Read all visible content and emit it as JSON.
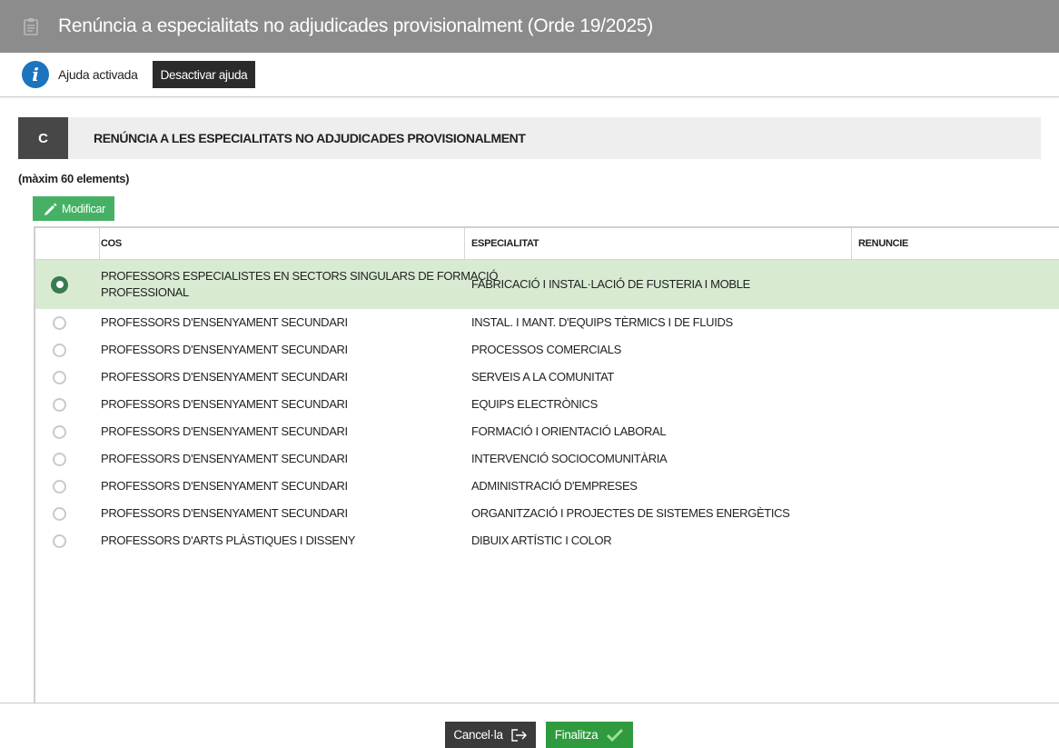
{
  "window": {
    "title": "Renúncia a especialitats no adjudicades provisionalment (Orde 19/2025)"
  },
  "help": {
    "status": "Ajuda activada",
    "toggle_label": "Desactivar ajuda"
  },
  "section": {
    "letter": "C",
    "title": "RENÚNCIA A LES ESPECIALITATS NO ADJUDICADES PROVISIONALMENT",
    "max_note": "(màxim 60 elements)",
    "modify_label": "Modificar"
  },
  "table": {
    "headers": {
      "cos": "COS",
      "especialitat": "ESPECIALITAT",
      "renuncie": "RENUNCIE"
    },
    "rows": [
      {
        "cos": "PROFESSORS ESPECIALISTES EN SECTORS SINGULARS DE FORMACIÓ PROFESSIONAL",
        "cos_line1": "PROFESSORS ESPECIALISTES EN SECTORS SINGULARS DE FORMACIÓ",
        "cos_line2": "PROFESSIONAL",
        "especialitat": "FABRICACIÓ I INSTAL·LACIÓ DE FUSTERIA I MOBLE",
        "renuncie": "",
        "selected": true
      },
      {
        "cos": "PROFESSORS D'ENSENYAMENT SECUNDARI",
        "especialitat": "INSTAL. I MANT. D'EQUIPS TÈRMICS I DE FLUIDS",
        "renuncie": "",
        "selected": false
      },
      {
        "cos": "PROFESSORS D'ENSENYAMENT SECUNDARI",
        "especialitat": "PROCESSOS COMERCIALS",
        "renuncie": "",
        "selected": false
      },
      {
        "cos": "PROFESSORS D'ENSENYAMENT SECUNDARI",
        "especialitat": "SERVEIS A LA COMUNITAT",
        "renuncie": "",
        "selected": false
      },
      {
        "cos": "PROFESSORS D'ENSENYAMENT SECUNDARI",
        "especialitat": "EQUIPS ELECTRÒNICS",
        "renuncie": "",
        "selected": false
      },
      {
        "cos": "PROFESSORS D'ENSENYAMENT SECUNDARI",
        "especialitat": "FORMACIÓ I ORIENTACIÓ LABORAL",
        "renuncie": "",
        "selected": false
      },
      {
        "cos": "PROFESSORS D'ENSENYAMENT SECUNDARI",
        "especialitat": "INTERVENCIÓ SOCIOCOMUNITÀRIA",
        "renuncie": "",
        "selected": false
      },
      {
        "cos": "PROFESSORS D'ENSENYAMENT SECUNDARI",
        "especialitat": "ADMINISTRACIÓ D'EMPRESES",
        "renuncie": "",
        "selected": false
      },
      {
        "cos": "PROFESSORS D'ENSENYAMENT SECUNDARI",
        "especialitat": "ORGANITZACIÓ I PROJECTES DE SISTEMES ENERGÈTICS",
        "renuncie": "",
        "selected": false
      },
      {
        "cos": "PROFESSORS D'ARTS PLÀSTIQUES I DISSENY",
        "especialitat": "DIBUIX ARTÍSTIC I COLOR",
        "renuncie": "",
        "selected": false
      }
    ]
  },
  "footer": {
    "cancel_label": "Cancel·la",
    "finish_label": "Finalitza"
  },
  "icons": {
    "window": "clipboard-icon",
    "help": "info-icon",
    "modify": "pencil-icon",
    "cancel": "exit-icon",
    "finish": "check-icon"
  },
  "colors": {
    "titlebar": "#8c8c8c",
    "selected_row": "#d8ebd2",
    "modify_button": "#46b165",
    "finish_button": "#2f9a3e",
    "info_icon": "#1c74bf"
  }
}
